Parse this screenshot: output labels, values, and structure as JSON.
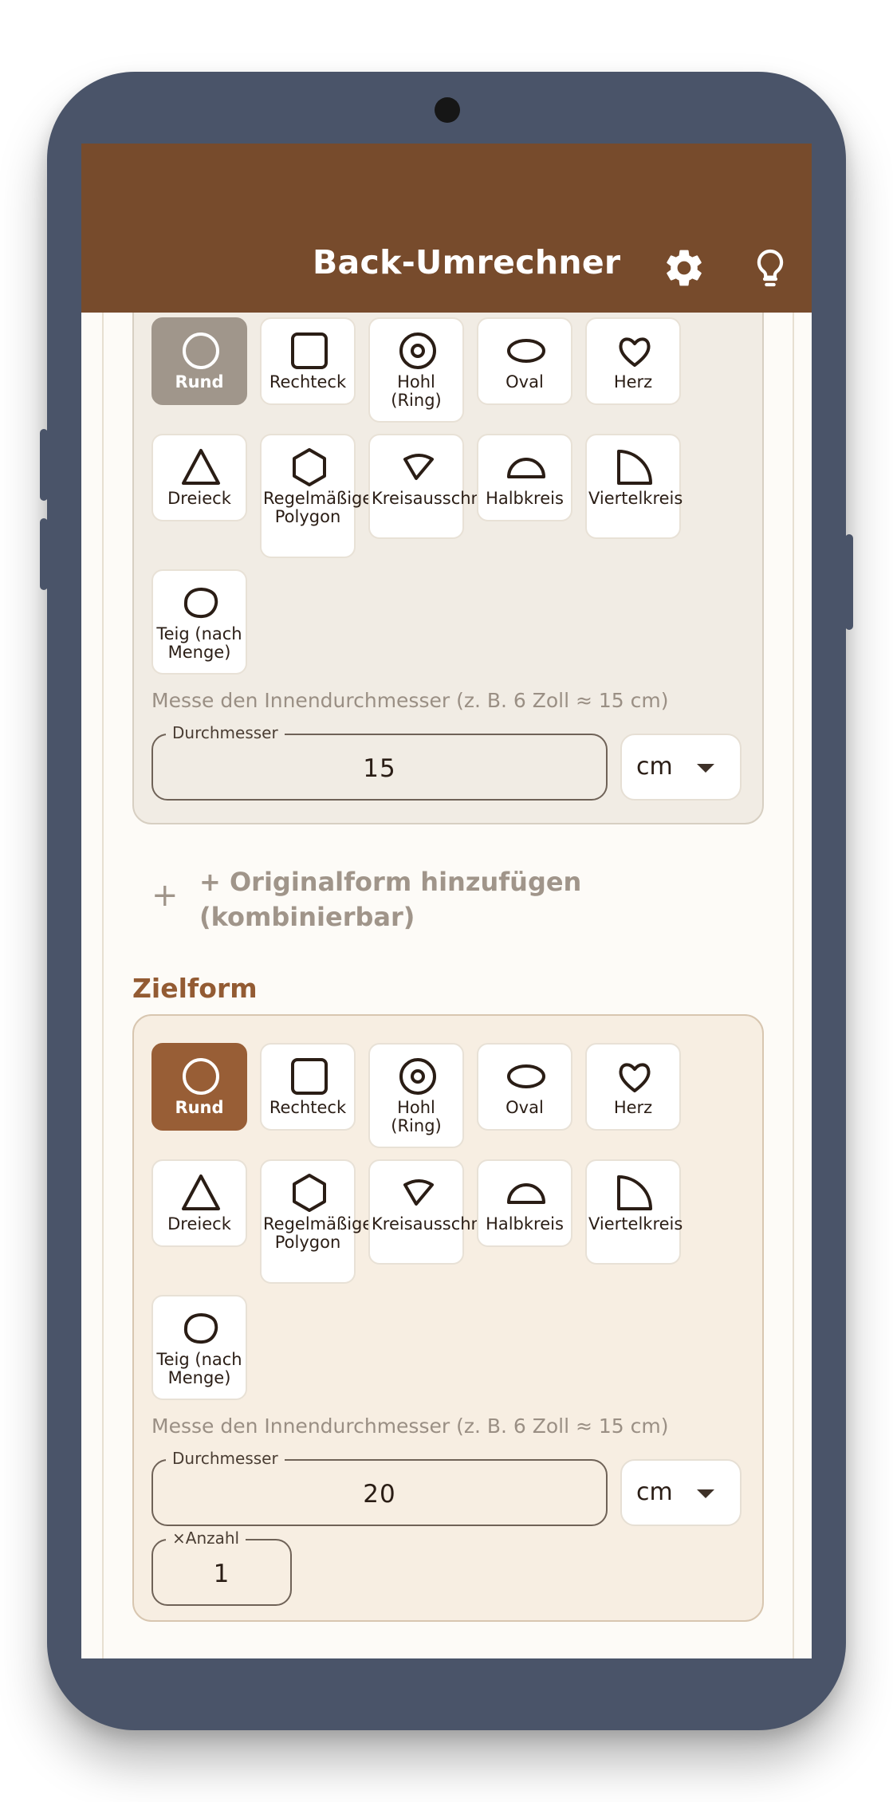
{
  "app": {
    "title": "Back-Umrechner",
    "bar_color": "#774b2c",
    "icons": [
      "gear-icon",
      "lightbulb-icon"
    ]
  },
  "shapes": [
    {
      "icon": "circle-icon",
      "label": "Rund"
    },
    {
      "icon": "square-icon",
      "label": "Rechteck"
    },
    {
      "icon": "ring-icon",
      "label": "Hohl (Ring)"
    },
    {
      "icon": "oval-icon",
      "label": "Oval"
    },
    {
      "icon": "heart-icon",
      "label": "Herz"
    },
    {
      "icon": "triangle-icon",
      "label": "Dreieck"
    },
    {
      "icon": "hexagon-icon",
      "label": "Regelmäßiges Polygon"
    },
    {
      "icon": "sector-icon",
      "label": "Kreisausschnitt"
    },
    {
      "icon": "semicircle-icon",
      "label": "Halbkreis"
    },
    {
      "icon": "quarter-circle-icon",
      "label": "Viertelkreis"
    },
    {
      "icon": "dough-icon",
      "label": "Teig (nach Menge)"
    }
  ],
  "original": {
    "selected_shape": "Rund",
    "hint": "Messe den Innendurchmesser (z. B. 6 Zoll ≈ 15 cm)",
    "diameter_label": "Durchmesser",
    "diameter_value": "15",
    "unit": "cm"
  },
  "add_original_button": "+ Originalform hinzufügen (kombinierbar)",
  "target": {
    "section_title": "Zielform",
    "selected_shape": "Rund",
    "hint": "Messe den Innendurchmesser (z. B. 6 Zoll ≈ 15 cm)",
    "diameter_label": "Durchmesser",
    "diameter_value": "20",
    "unit": "cm",
    "count_label": "×Anzahl",
    "count_value": "1"
  },
  "colors": {
    "selected_original": "#a0968b",
    "selected_target": "#985e36",
    "accent": "#935b33"
  }
}
